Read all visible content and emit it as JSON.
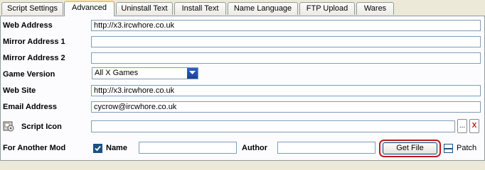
{
  "tabs": [
    {
      "label": "Script Settings"
    },
    {
      "label": "Advanced"
    },
    {
      "label": "Uninstall Text"
    },
    {
      "label": "Install Text"
    },
    {
      "label": "Name Language"
    },
    {
      "label": "FTP Upload"
    },
    {
      "label": "Wares"
    }
  ],
  "active_tab": "Advanced",
  "form": {
    "web_address": {
      "label": "Web Address",
      "value": "http://x3.ircwhore.co.uk"
    },
    "mirror1": {
      "label": "Mirror Address 1",
      "value": ""
    },
    "mirror2": {
      "label": "Mirror Address 2",
      "value": ""
    },
    "game_version": {
      "label": "Game Version",
      "value": "All X Games"
    },
    "web_site": {
      "label": "Web Site",
      "value": "http://x3.ircwhore.co.uk"
    },
    "email": {
      "label": "Email Address",
      "value": "cycrow@ircwhore.co.uk"
    },
    "script_icon": {
      "label": "Script Icon",
      "value": "",
      "browse_label": "...",
      "clear_label": "X"
    },
    "another_mod": {
      "label": "For Another Mod",
      "name_label": "Name",
      "name_checked": true,
      "name_value": "",
      "author_label": "Author",
      "author_value": "",
      "get_file_label": "Get File",
      "patch_label": "Patch",
      "patch_checked": false
    }
  },
  "colors": {
    "accent_tab": "#ffc83c",
    "highlight": "#c01818",
    "check": "#1c5180"
  }
}
